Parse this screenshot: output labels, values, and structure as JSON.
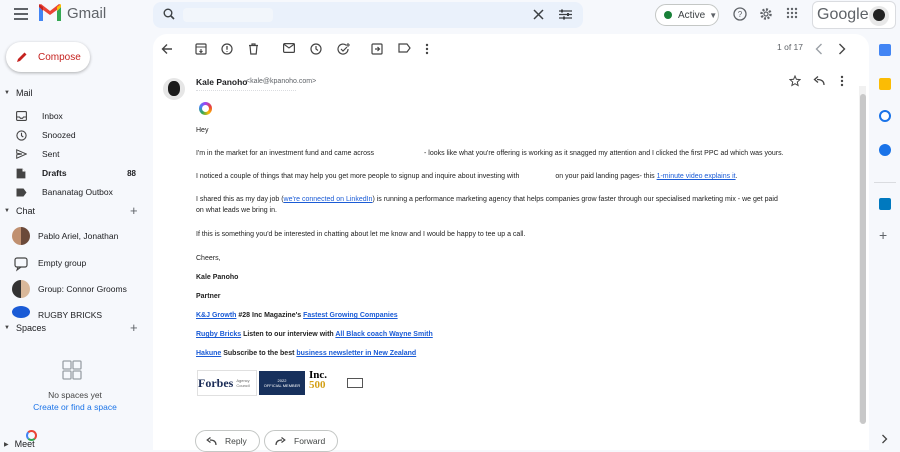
{
  "app": {
    "name": "Gmail"
  },
  "topbar": {
    "status_label": "Active",
    "brand_word": "Google",
    "status_color": "#188038"
  },
  "sidebar": {
    "compose_label": "Compose",
    "mail_heading": "Mail",
    "items": [
      {
        "label": "Inbox",
        "icon": "inbox-icon"
      },
      {
        "label": "Snoozed",
        "icon": "clock-icon"
      },
      {
        "label": "Sent",
        "icon": "send-icon"
      },
      {
        "label": "Drafts",
        "icon": "draft-icon",
        "count": "88"
      },
      {
        "label": "Bananatag Outbox",
        "icon": "label-icon"
      }
    ],
    "chat_heading": "Chat",
    "chats": [
      {
        "label": "Pablo Ariel, Jonathan"
      },
      {
        "label": "Empty group"
      },
      {
        "label": "Group: Connor Grooms"
      },
      {
        "label": "RUGBY BRICKS"
      }
    ],
    "spaces_heading": "Spaces",
    "no_spaces": "No spaces yet",
    "create_space": "Create or find a space",
    "meet_heading": "Meet"
  },
  "toolbar": {
    "pager": "1 of 17"
  },
  "email": {
    "sender_name": "Kale Panoho",
    "sender_email": "<kale@kpanoho.com>",
    "greeting": "Hey",
    "p1_a": "I'm in the market for an investment fund and came across",
    "p1_b": "- looks like what you're offering is working as it snagged my attention and I clicked the first PPC ad which was yours.",
    "p2_a": "I noticed a couple of things that may help you get more people to signup and inquire about investing with",
    "p2_b": "on your paid landing pages- this",
    "p2_link": "1-minute video explains it",
    "p2_c": ".",
    "p3_a": "I shared this as my day job (",
    "p3_link": "we're connected on LinkedIn",
    "p3_b": ") is running a performance marketing agency that helps companies grow faster through our specialised marketing mix - we get paid",
    "p3_c": "on what leads we bring in.",
    "p4": "If this is something you'd be interested in chatting about let me know and I would be happy to tee up a call.",
    "closing": "Cheers,",
    "sig_name": "Kale Panoho",
    "sig_title": "Partner",
    "sig1_link": "K&J Growth",
    "sig1_text": " #28 Inc Magazine's ",
    "sig1_link2": "Fastest Growing Companies",
    "sig2_link": "Rugby Bricks",
    "sig2_text": " Listen to our interview with ",
    "sig2_link2": "All Black coach Wayne Smith",
    "sig3_link": "Hakune",
    "sig3_text": " Subscribe to the best ",
    "sig3_link2": "business newsletter in New Zealand",
    "badge_forbes": "Forbes",
    "badge_forbes_sub": "Agency Council",
    "badge_official_year": "2022",
    "badge_official_label": "OFFICIAL MEMBER",
    "badge_inc": "Inc.",
    "badge_inc_num": "500"
  },
  "actions": {
    "reply": "Reply",
    "forward": "Forward"
  }
}
